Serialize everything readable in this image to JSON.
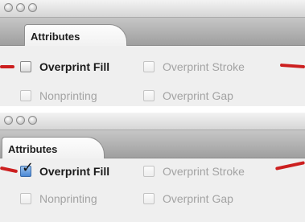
{
  "panels": [
    {
      "tab_label": "Attributes",
      "overprint_fill": {
        "label": "Overprint Fill",
        "checked": false
      },
      "overprint_stroke": {
        "label": "Overprint Stroke"
      },
      "nonprinting": {
        "label": "Nonprinting"
      },
      "overprint_gap": {
        "label": "Overprint Gap"
      }
    },
    {
      "tab_label": "Attributes",
      "overprint_fill": {
        "label": "Overprint Fill",
        "checked": true
      },
      "overprint_stroke": {
        "label": "Overprint Stroke"
      },
      "nonprinting": {
        "label": "Nonprinting"
      },
      "overprint_gap": {
        "label": "Overprint Gap"
      }
    }
  ],
  "colors": {
    "annotation_arrow": "#cc1f1f",
    "checkbox_checked": "#4a88d4"
  },
  "icons": {
    "window_buttons": "traffic-light-icon",
    "checkmark": "checkmark-icon"
  }
}
